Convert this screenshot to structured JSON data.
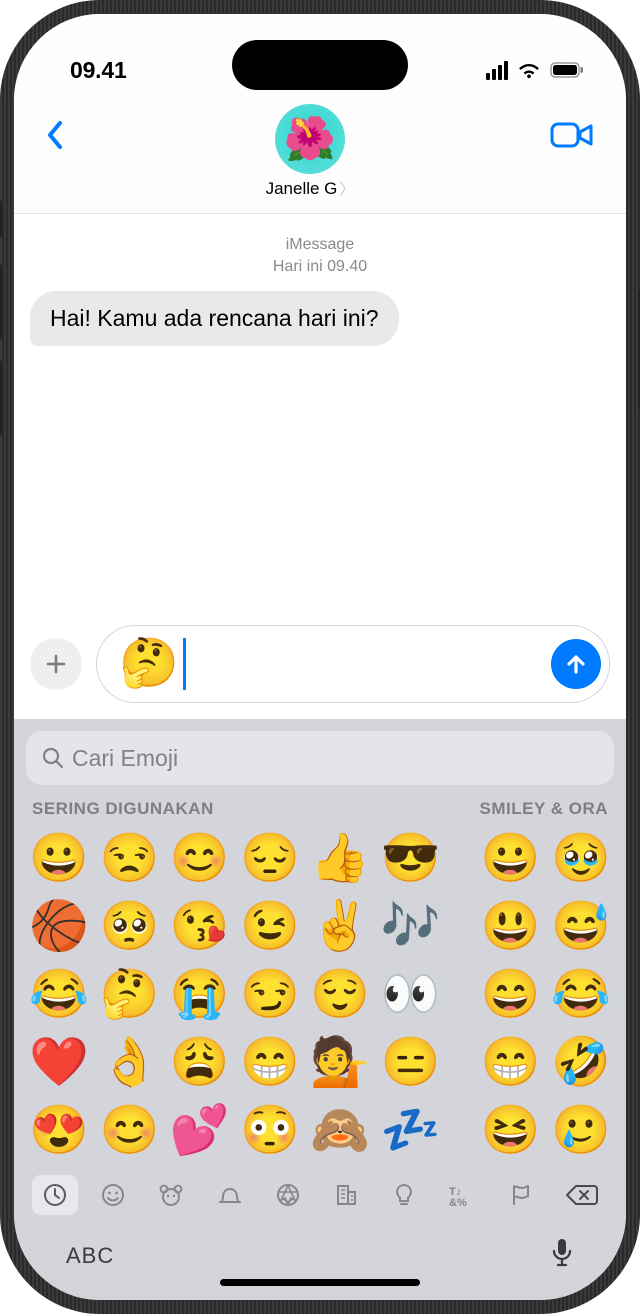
{
  "status": {
    "time": "09.41"
  },
  "nav": {
    "contact_name": "Janelle G",
    "avatar_emoji": "🌺"
  },
  "thread": {
    "service": "iMessage",
    "timestamp": "Hari ini 09.40",
    "incoming": "Hai! Kamu ada rencana hari ini?"
  },
  "compose": {
    "content": "🤔"
  },
  "keyboard": {
    "search_placeholder": "Cari Emoji",
    "section_left": "SERING DIGUNAKAN",
    "section_right": "SMILEY & ORA",
    "abc_label": "ABC",
    "rows": [
      {
        "left": [
          "😀",
          "😒",
          "😊",
          "😔",
          "👍",
          "😎"
        ],
        "right": [
          "😀",
          "🥹"
        ]
      },
      {
        "left": [
          "🏀",
          "🥺",
          "😘",
          "😉",
          "✌️",
          "🎶"
        ],
        "right": [
          "😃",
          "😅"
        ]
      },
      {
        "left": [
          "😂",
          "🤔",
          "😭",
          "😏",
          "😌",
          "👀"
        ],
        "right": [
          "😄",
          "😂"
        ]
      },
      {
        "left": [
          "❤️",
          "👌",
          "😩",
          "😁",
          "💁",
          "😑"
        ],
        "right": [
          "😁",
          "🤣"
        ]
      },
      {
        "left": [
          "😍",
          "😊",
          "💕",
          "😳",
          "🙈",
          "💤"
        ],
        "right": [
          "😆",
          "🥲"
        ]
      }
    ]
  }
}
